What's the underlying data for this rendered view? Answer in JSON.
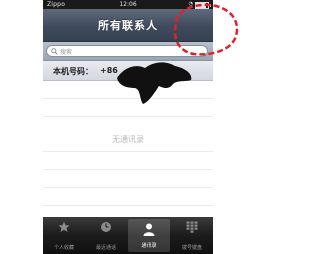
{
  "status_bar": {
    "carrier": "Zippo",
    "time": "12:06",
    "battery_level": 0.85
  },
  "nav_bar": {
    "title": "所有联系人"
  },
  "search": {
    "placeholder": "搜索"
  },
  "my_number": {
    "label": "本机号码：",
    "value": "+86"
  },
  "list": {
    "empty_text": "无通讯录"
  },
  "tab_bar": {
    "tabs": [
      {
        "label": "个人收藏",
        "icon": "star-icon",
        "selected": false
      },
      {
        "label": "最近通话",
        "icon": "clock-icon",
        "selected": false
      },
      {
        "label": "通讯录",
        "icon": "contacts-icon",
        "selected": true
      },
      {
        "label": "拨号键盘",
        "icon": "keypad-icon",
        "selected": false
      }
    ]
  },
  "colors": {
    "annotation": "#e0202a",
    "nav_bar": "#3f4b5c",
    "tab_bar": "#1c1c1c"
  }
}
